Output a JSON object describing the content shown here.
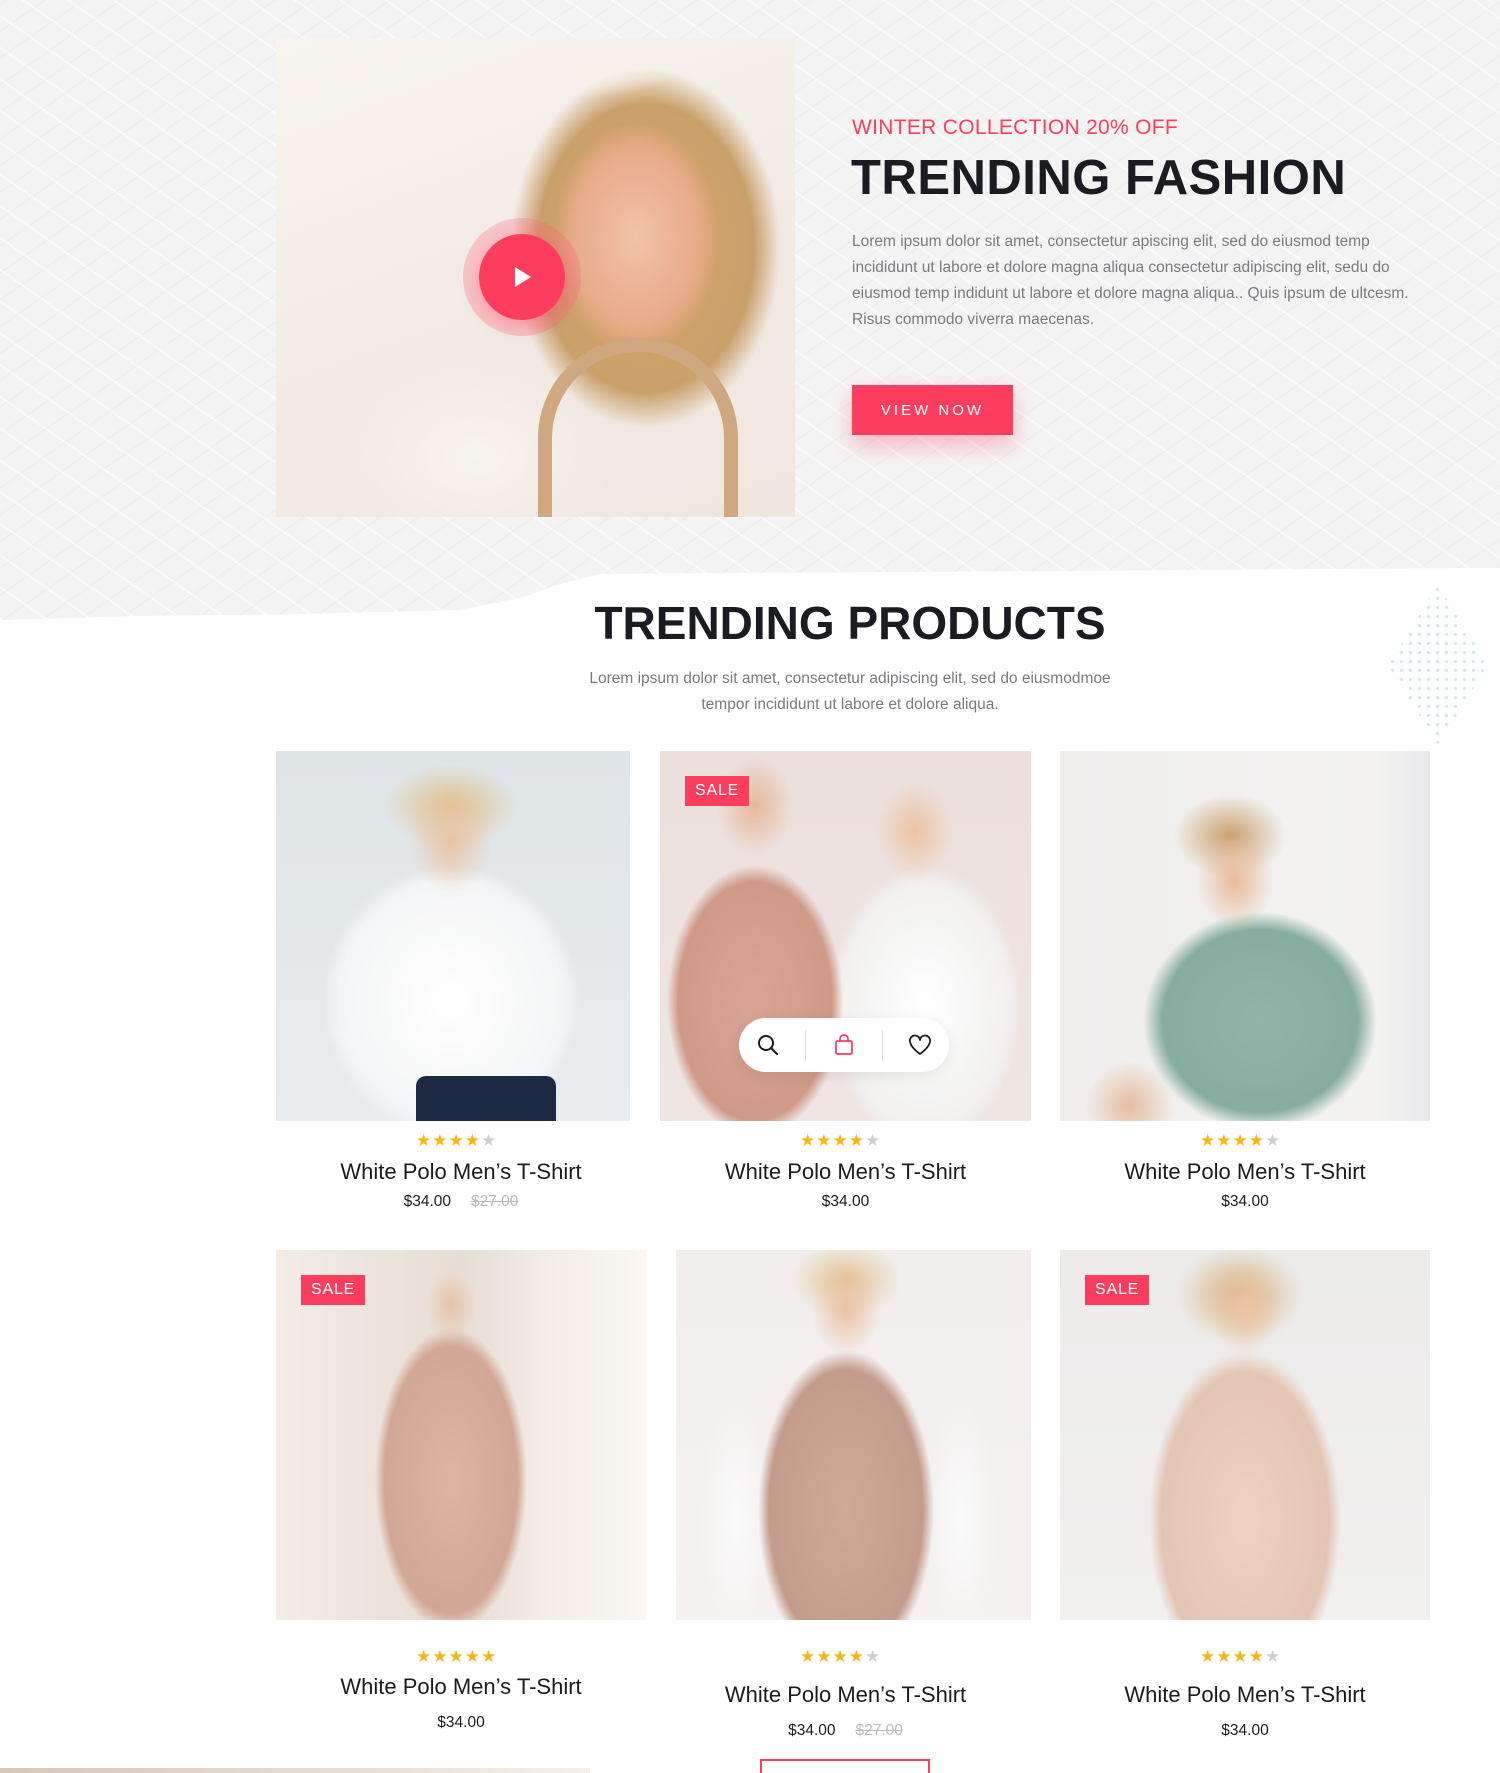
{
  "hero": {
    "eyebrow": "WINTER COLLECTION 20% OFF",
    "title": "TRENDING FASHION",
    "description": "Lorem ipsum dolor sit amet, consectetur apiscing elit, sed do eiusmod temp incididunt ut labore et dolore magna aliqua consectetur adipiscing elit, sedu do eiusmod temp indidunt ut labore et dolore magna aliqua.. Quis ipsum de ultcesm. Risus commodo viverra maecenas.",
    "button_label": "VIEW NOW",
    "play_icon": "play-icon"
  },
  "section": {
    "title": "TRENDING PRODUCTS",
    "subtitle_line1": "Lorem ipsum dolor sit amet, consectetur adipiscing elit, sed do eiusmodmoe",
    "subtitle_line2": "tempor incididunt ut labore et dolore aliqua."
  },
  "products": [
    {
      "name": "White Polo Men’s T-Shirt",
      "price": "$34.00",
      "old_price": "$27.00",
      "sale": "",
      "rating": 4
    },
    {
      "name": "White Polo Men’s T-Shirt",
      "price": "$34.00",
      "old_price": "",
      "sale": "SALE",
      "rating": 4
    },
    {
      "name": "White Polo Men’s T-Shirt",
      "price": "$34.00",
      "old_price": "",
      "sale": "",
      "rating": 4
    },
    {
      "name": "White Polo Men’s T-Shirt",
      "price": "$34.00",
      "old_price": "",
      "sale": "SALE",
      "rating": 5
    },
    {
      "name": "White Polo Men’s T-Shirt",
      "price": "$34.00",
      "old_price": "$27.00",
      "sale": "",
      "rating": 4
    },
    {
      "name": "White Polo Men’s T-Shirt",
      "price": "$34.00",
      "old_price": "",
      "sale": "SALE",
      "rating": 4
    }
  ],
  "card_actions": [
    "search-icon",
    "shopping-bag-icon",
    "heart-icon"
  ],
  "colors": {
    "accent": "#fc3d5e",
    "star": "#f6b511",
    "heading": "#1b1b22",
    "muted": "#7a7a82"
  }
}
